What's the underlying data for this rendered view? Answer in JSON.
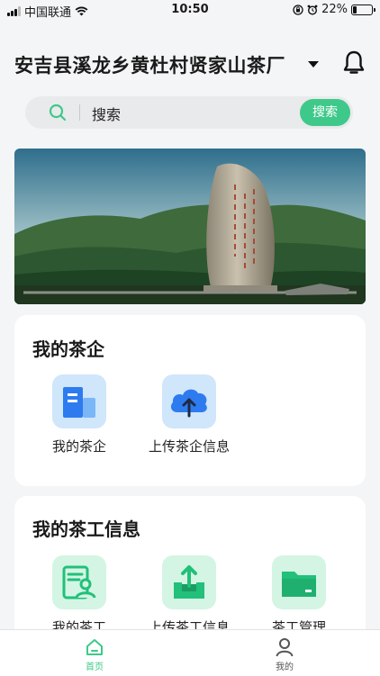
{
  "status_bar": {
    "carrier": "中国联通",
    "time": "10:50",
    "battery_text": "22%",
    "battery_level": 0.22,
    "icons": [
      "signal-icon",
      "wifi-icon",
      "orientation-lock-icon",
      "alarm-icon",
      "battery-icon"
    ]
  },
  "header": {
    "title": "安吉县溪龙乡黄杜村贤家山茶厂",
    "dropdown_icon": "caret-down-icon",
    "notification_icon": "bell-icon"
  },
  "search": {
    "placeholder": "搜索",
    "button_label": "搜索",
    "icon": "search-icon"
  },
  "banner": {
    "description_icon": "banner-image"
  },
  "sections": [
    {
      "title": "我的茶企",
      "items": [
        {
          "label": "我的茶企",
          "icon": "building-icon"
        },
        {
          "label": "上传茶企信息",
          "icon": "cloud-upload-icon"
        }
      ]
    },
    {
      "title": "我的茶工信息",
      "items": [
        {
          "label": "我的茶工",
          "icon": "worker-profile-icon"
        },
        {
          "label": "上传茶工信息",
          "icon": "upload-tray-icon"
        },
        {
          "label": "茶工管理",
          "icon": "folder-icon"
        }
      ]
    }
  ],
  "tab_bar": {
    "tabs": [
      {
        "label": "首页",
        "icon": "home-icon",
        "active": true
      },
      {
        "label": "我的",
        "icon": "user-icon",
        "active": false
      }
    ]
  },
  "colors": {
    "accent": "#3ec98a",
    "tab_active": "#3ec98a",
    "tab_inactive": "#555555",
    "blue_icon": "#2e7bf0",
    "green_icon": "#22c07a"
  }
}
